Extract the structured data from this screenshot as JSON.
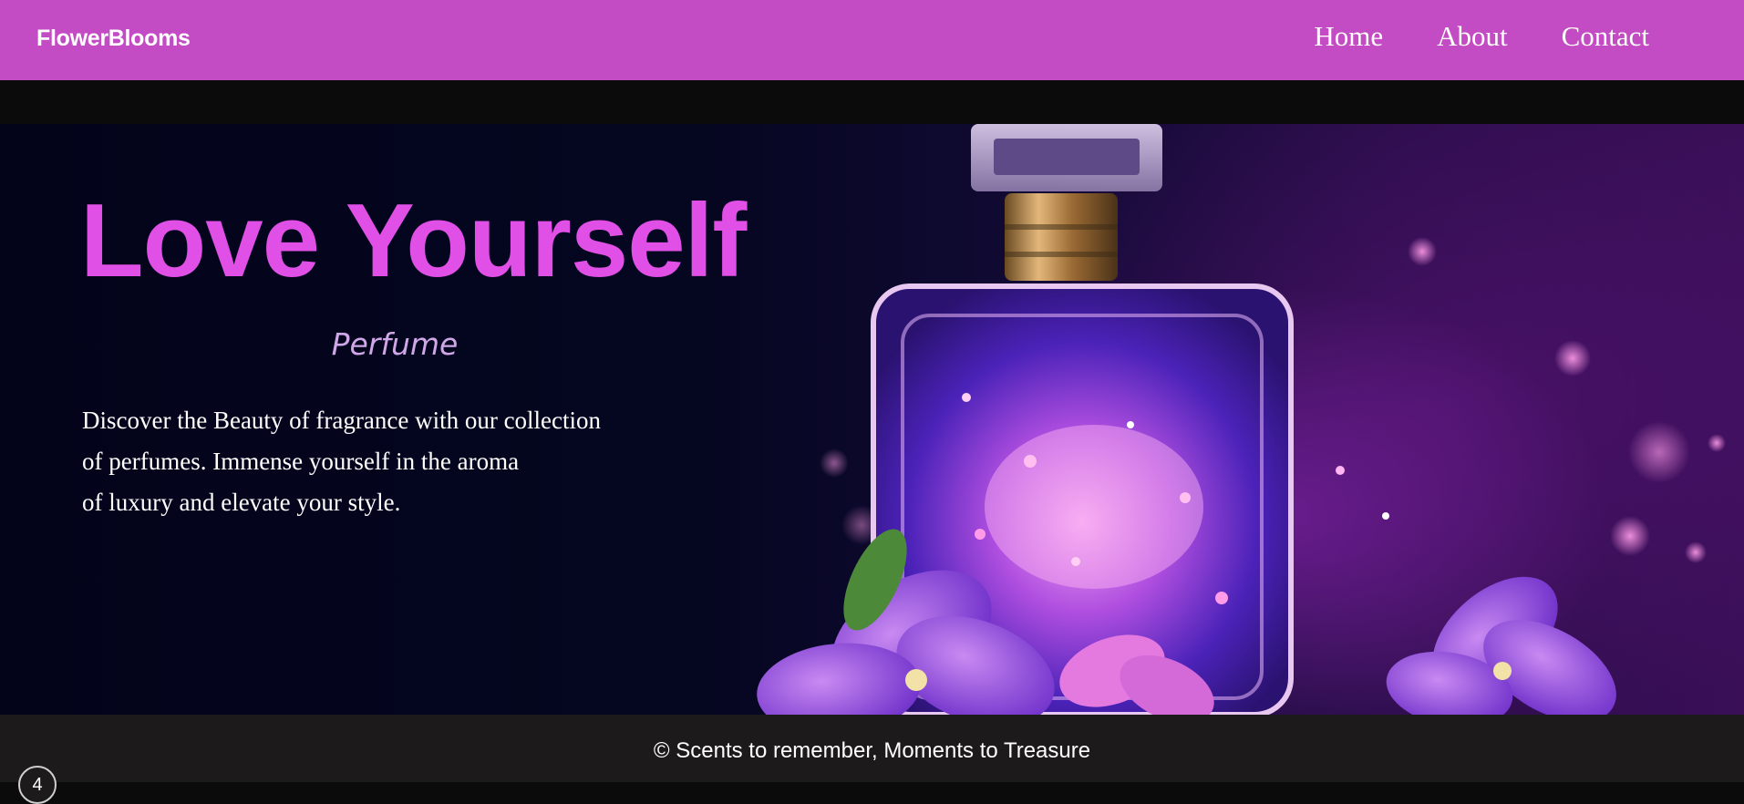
{
  "navbar": {
    "brand": "FlowerBlooms",
    "links": [
      {
        "label": "Home"
      },
      {
        "label": "About"
      },
      {
        "label": "Contact"
      }
    ],
    "background": "#c34bc3"
  },
  "hero": {
    "title": "Love Yourself",
    "subtitle": "Perfume",
    "description_lines": [
      "Discover the Beauty of fragrance with our collection",
      "of perfumes. Immense yourself in the aroma",
      "of luxury and elevate your style."
    ],
    "image_icon": "perfume-bottle-with-flowers",
    "title_color": "#e04fe6",
    "subtitle_color": "#cfa7e8"
  },
  "footer": {
    "text": "© Scents to remember, Moments to Treasure",
    "background": "#1c1a1b"
  },
  "scroll_badge": {
    "label": "4"
  }
}
